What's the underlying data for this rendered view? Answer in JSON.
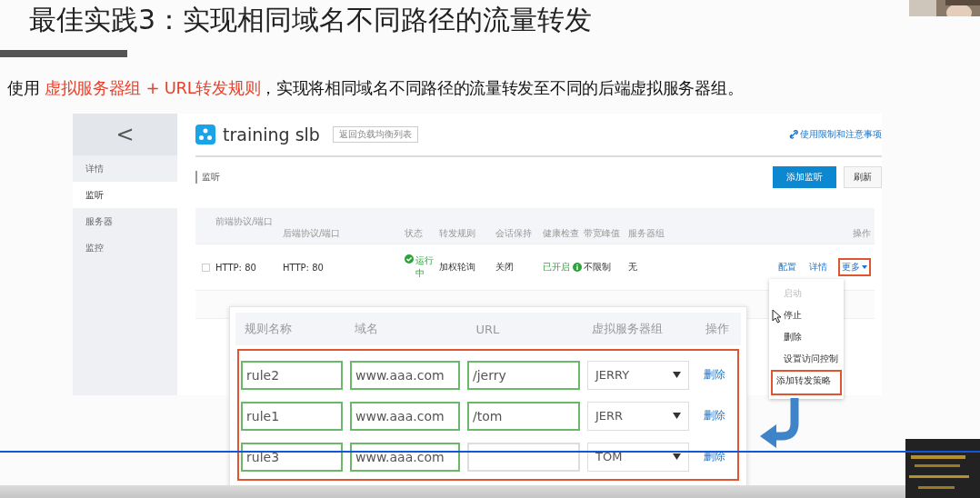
{
  "slide": {
    "title": "最佳实践3：实现相同域名不同路径的流量转发",
    "subtitle": "使用 **虚拟服务器组 + URL转发规则**，实现将相同域名不同路径的流量转发至不同的后端虚拟服务器组。"
  },
  "console": {
    "sidebar": {
      "back": "<",
      "items": [
        {
          "label": "详情",
          "selected": false
        },
        {
          "label": "监听",
          "selected": true
        },
        {
          "label": "服务器",
          "selected": false
        },
        {
          "label": "监控",
          "selected": false
        }
      ]
    },
    "header": {
      "title": "training  slb",
      "back_link": "返回负载均衡列表",
      "help_link": "使用限制和注意事项"
    },
    "section": "监听",
    "buttons": [
      {
        "label": "添加监听",
        "kind": "primary"
      },
      {
        "label": "刷新",
        "kind": "plain"
      }
    ],
    "table": {
      "columns": [
        "前端协议/端口",
        "后端协议/端口",
        "状态",
        "转发规则",
        "会话保持",
        "健康检查",
        "带宽峰值",
        "服务器组",
        "操作"
      ],
      "rows": [
        {
          "checked": false,
          "frontend": "HTTP: 80",
          "backend": "HTTP: 80",
          "status": "运行中",
          "rule": "加权轮询",
          "session": "关闭",
          "health": "已开启",
          "bandwidth": "不限制",
          "group": "无",
          "actions": [
            {
              "label": "配置",
              "dropdown": false,
              "highlighted": false
            },
            {
              "label": "详情",
              "dropdown": false,
              "highlighted": false
            },
            {
              "label": "更多",
              "dropdown": true,
              "highlighted": true
            }
          ]
        }
      ]
    }
  },
  "menu": [
    {
      "label": "启动",
      "disabled": true,
      "highlighted": false
    },
    {
      "label": "停止",
      "disabled": false,
      "highlighted": false
    },
    {
      "label": "删除",
      "disabled": false,
      "highlighted": false
    },
    {
      "label": "设置访问控制",
      "disabled": false,
      "highlighted": false
    },
    {
      "label": "添加转发策略",
      "disabled": false,
      "highlighted": true
    }
  ],
  "rules_dialog": {
    "columns": [
      "规则名称",
      "域名",
      "URL",
      "虚拟服务器组",
      "操作"
    ],
    "rules": [
      {
        "name": "rule2",
        "domain": "www.aaa.com",
        "url": "/jerry",
        "group": "JERRY",
        "delete": "删除"
      },
      {
        "name": "rule1",
        "domain": "www.aaa.com",
        "url": "/tom",
        "group": "JERR",
        "delete": "删除"
      },
      {
        "name": "rule3",
        "domain": "www.aaa.com",
        "group": "TOM",
        "delete": "删除"
      }
    ]
  },
  "player": {
    "progress": {
      "level": 1
    }
  }
}
